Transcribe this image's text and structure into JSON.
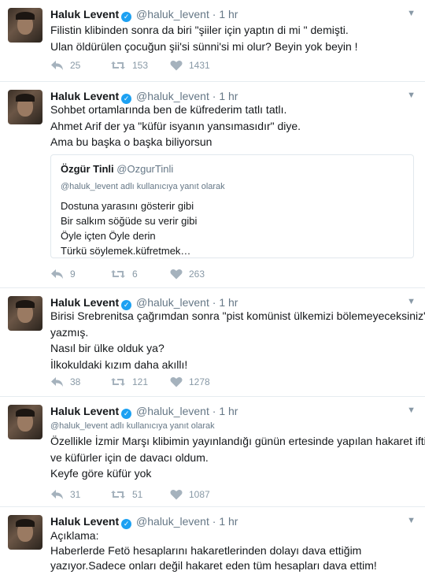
{
  "colors": {
    "accent": "#1da1f2",
    "muted": "#657786",
    "icon": "#8899a6",
    "border": "#e6ecf0"
  },
  "icons": {
    "verified": "verified-badge-icon",
    "caret": "chevron-down-icon",
    "reply": "reply-icon",
    "retweet": "retweet-icon",
    "like": "heart-icon"
  },
  "tweets": [
    {
      "name": "Haluk Levent",
      "handle": "@haluk_levent",
      "dot": "·",
      "time": "1 hr",
      "lines": [
        "Filistin klibinden sonra da biri \"şiiler için yaptın di mi \" demişti.",
        "Ulan öldürülen çocuğun şii'si sünni'si mi olur? Beyin yok beyin !"
      ],
      "replies": "25",
      "retweets": "153",
      "likes": "1431"
    },
    {
      "name": "Haluk Levent",
      "handle": "@haluk_levent",
      "dot": "·",
      "time": "1 hr",
      "lines": [
        "Sohbet ortamlarında ben de küfrederim tatlı tatlı.",
        "Ahmet Arif der ya \"küfür isyanın yansımasıdır\" diye.",
        "Ama bu başka o başka biliyorsun"
      ],
      "quote": {
        "name": "Özgür Tinli",
        "handle": "@OzgurTinli",
        "reply_to": "@haluk_levent adlı kullanıcıya yanıt olarak",
        "lines": [
          "Dostuna yarasını gösterir gibi",
          "Bir salkım söğüde su verir gibi",
          "Öyle içten Öyle derin",
          "Türkü söylemek.küfretmek…"
        ]
      },
      "replies": "9",
      "retweets": "6",
      "likes": "263"
    },
    {
      "name": "Haluk Levent",
      "handle": "@haluk_levent",
      "dot": "·",
      "time": "1 hr",
      "lines": [
        "Birisi Srebrenitsa çağrımdan sonra \"pist komünist ülkemizi bölemeyeceksiniz\"",
        "yazmış.",
        "Nasıl bir ülke olduk ya?",
        "İlkokuldaki kızım daha akıllı!"
      ],
      "replies": "38",
      "retweets": "121",
      "likes": "1278"
    },
    {
      "name": "Haluk Levent",
      "handle": "@haluk_levent",
      "dot": "·",
      "time": "1 hr",
      "reply_to": "@haluk_levent adlı kullanıcıya yanıt olarak",
      "lines": [
        "Özellikle İzmir Marşı klibimin yayınlandığı günün ertesinde yapılan hakaret iftira",
        "ve küfürler için de davacı oldum.",
        "Keyfe göre küfür yok"
      ],
      "replies": "31",
      "retweets": "51",
      "likes": "1087"
    },
    {
      "name": "Haluk Levent",
      "handle": "@haluk_levent",
      "dot": "·",
      "time": "1 hr",
      "lines": [
        "Açıklama:",
        "Haberlerde Fetö hesaplarını hakaretlerinden dolayı dava ettiğim",
        "yazıyor.Sadece onları değil hakaret eden tüm hesapları dava ettim!"
      ]
    }
  ]
}
